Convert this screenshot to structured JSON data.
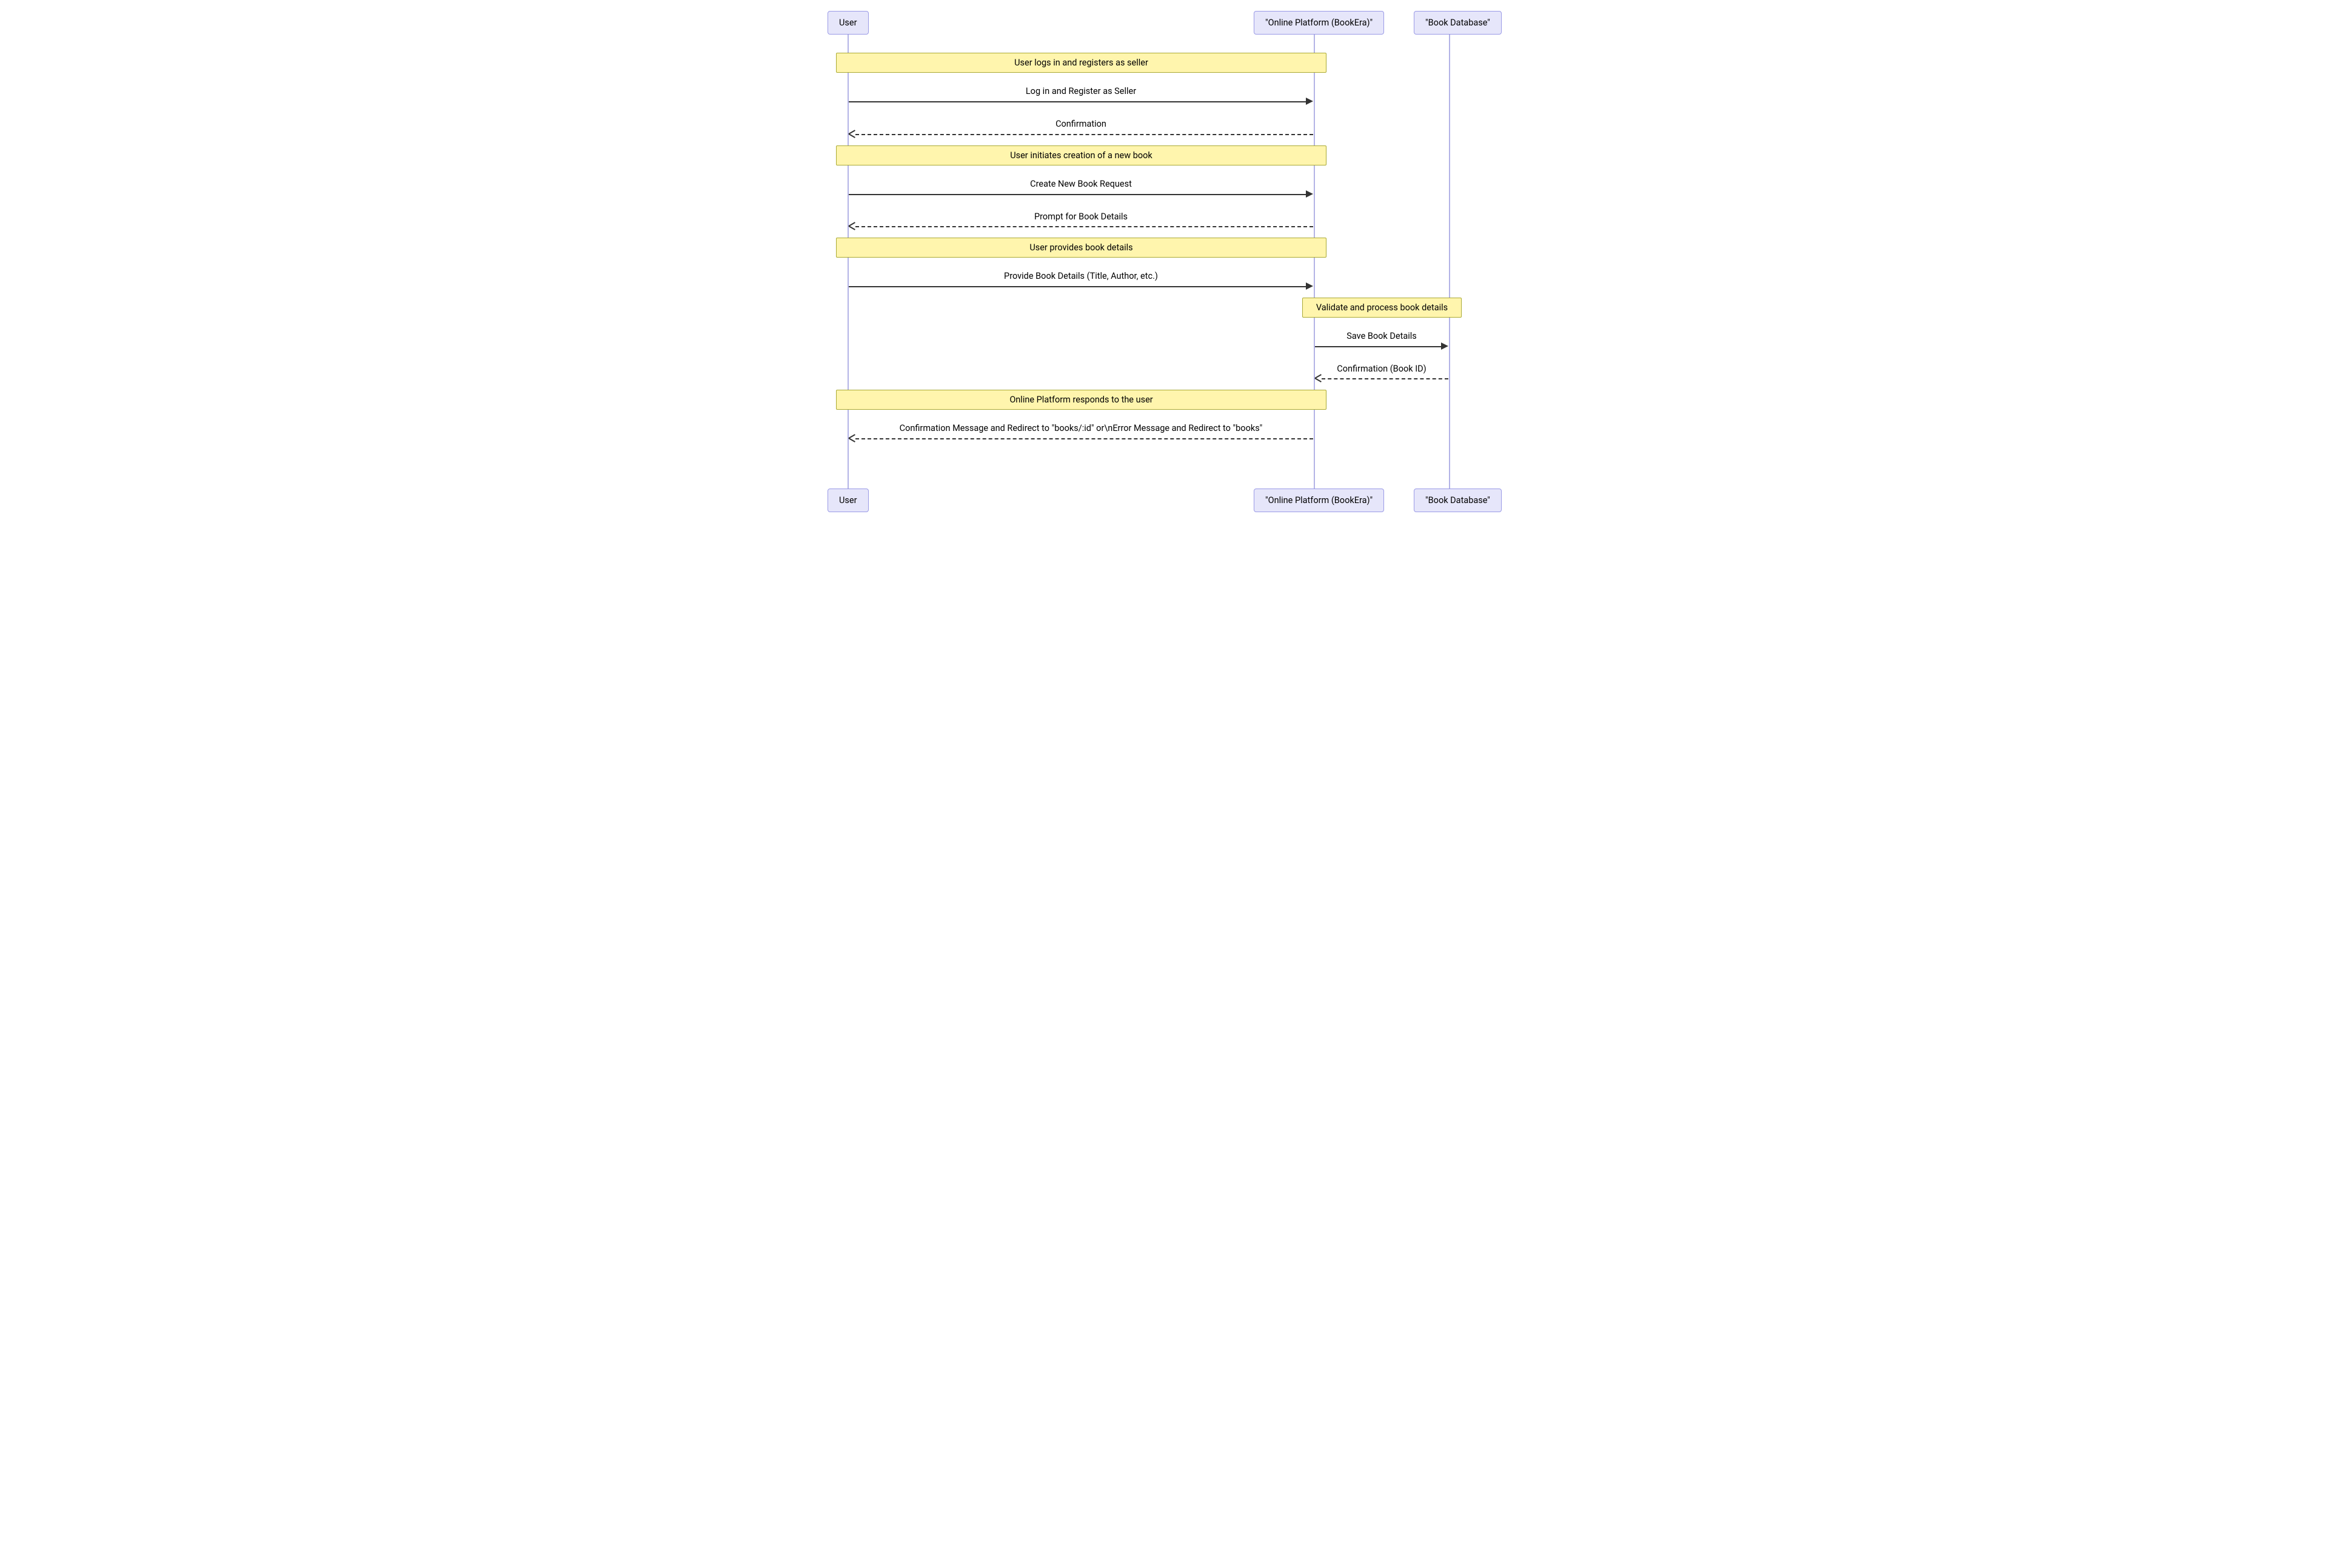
{
  "actors": {
    "user": "User",
    "platform": "\"Online Platform (BookEra)\"",
    "database": "\"Book Database\""
  },
  "notes": {
    "n1": "User logs in and registers as seller",
    "n2": "User initiates creation of a new book",
    "n3": "User provides book details",
    "n4": "Validate and process book details",
    "n5": "Online Platform responds to the user"
  },
  "messages": {
    "m1": "Log in and Register as Seller",
    "m2": "Confirmation",
    "m3": "Create New Book Request",
    "m4": "Prompt for Book Details",
    "m5": "Provide Book Details (Title, Author, etc.)",
    "m6": "Save Book Details",
    "m7": "Confirmation (Book ID)",
    "m8": "Confirmation Message and Redirect to \"books/:id\" or\\nError Message and Redirect to \"books\""
  }
}
